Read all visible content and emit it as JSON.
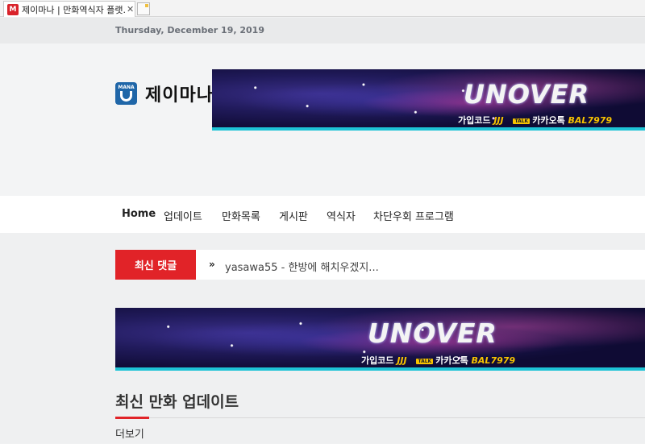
{
  "browser": {
    "tab_title": "제이마나 | 만화역식자 플랫...",
    "favicon_glyph": "M",
    "close_glyph": "✕"
  },
  "date": "Thursday, December 19, 2019",
  "site": {
    "logo_mark_text": "MANA",
    "name": "제이마나"
  },
  "banner": {
    "logo": "UNOVER",
    "code_label": "가입코드",
    "code_value": "JJJ",
    "talk_badge": "TALK",
    "kakao_label": "카카오톡",
    "kakao_value": "BAL7979"
  },
  "nav": {
    "items": [
      "Home",
      "업데이트",
      "만화목록",
      "게시판",
      "역식자",
      "차단우회 프로그램"
    ]
  },
  "ticker": {
    "button_label": "최신 댓글",
    "arrow": "»",
    "text": "yasawa55 - 한방에 해치우겠지..."
  },
  "section": {
    "title": "최신 만화 업데이트",
    "more_label": "더보기"
  },
  "colors": {
    "accent_red": "#e12328",
    "logo_blue": "#1f66a8",
    "banner_cyan": "#1ec3d6",
    "banner_yellow": "#f7c300"
  }
}
